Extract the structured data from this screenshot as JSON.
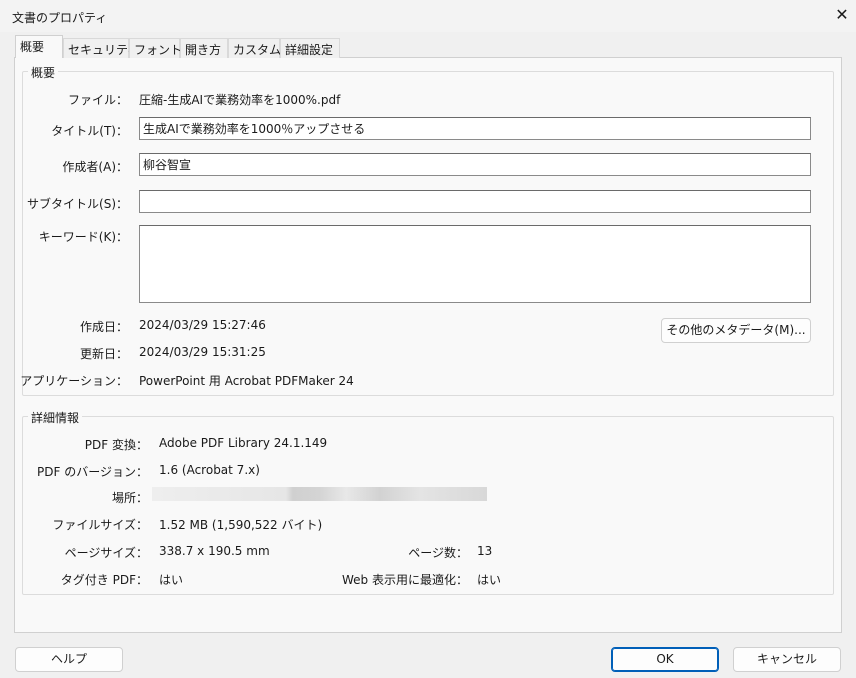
{
  "window": {
    "title": "文書のプロパティ",
    "close_icon": "close-icon"
  },
  "tabs": [
    {
      "label": "概要",
      "active": true
    },
    {
      "label": "セキュリティ"
    },
    {
      "label": "フォント"
    },
    {
      "label": "開き方"
    },
    {
      "label": "カスタム"
    },
    {
      "label": "詳細設定"
    }
  ],
  "summary": {
    "group_label": "概要",
    "file_label": "ファイル：",
    "file_value": "圧縮-生成AIで業務効率を1000%.pdf",
    "title_label": "タイトル(T)：",
    "title_value": "生成AIで業務効率を1000％アップさせる",
    "author_label": "作成者(A)：",
    "author_value": "柳谷智宣",
    "subtitle_label": "サブタイトル(S)：",
    "subtitle_value": "",
    "keywords_label": "キーワード(K)：",
    "keywords_value": "",
    "created_label": "作成日：",
    "created_value": "2024/03/29 15:27:46",
    "modified_label": "更新日：",
    "modified_value": "2024/03/29 15:31:25",
    "app_label": "アプリケーション：",
    "app_value": "PowerPoint 用 Acrobat PDFMaker 24",
    "more_metadata_button": "その他のメタデータ(M)..."
  },
  "details": {
    "group_label": "詳細情報",
    "producer_label": "PDF 変換：",
    "producer_value": "Adobe PDF Library 24.1.149",
    "version_label": "PDF のバージョン：",
    "version_value": "1.6 (Acrobat 7.x)",
    "location_label": "場所：",
    "size_label": "ファイルサイズ：",
    "size_value": "1.52 MB (1,590,522 バイト)",
    "pagesize_label": "ページサイズ：",
    "pagesize_value": "338.7 x 190.5 mm",
    "pages_label": "ページ数：",
    "pages_value": "13",
    "tagged_label": "タグ付き PDF：",
    "tagged_value": "はい",
    "fastweb_label": "Web 表示用に最適化：",
    "fastweb_value": "はい"
  },
  "buttons": {
    "help": "ヘルプ",
    "ok": "OK",
    "cancel": "キャンセル"
  },
  "colors": {
    "accent": "#005fb8"
  }
}
